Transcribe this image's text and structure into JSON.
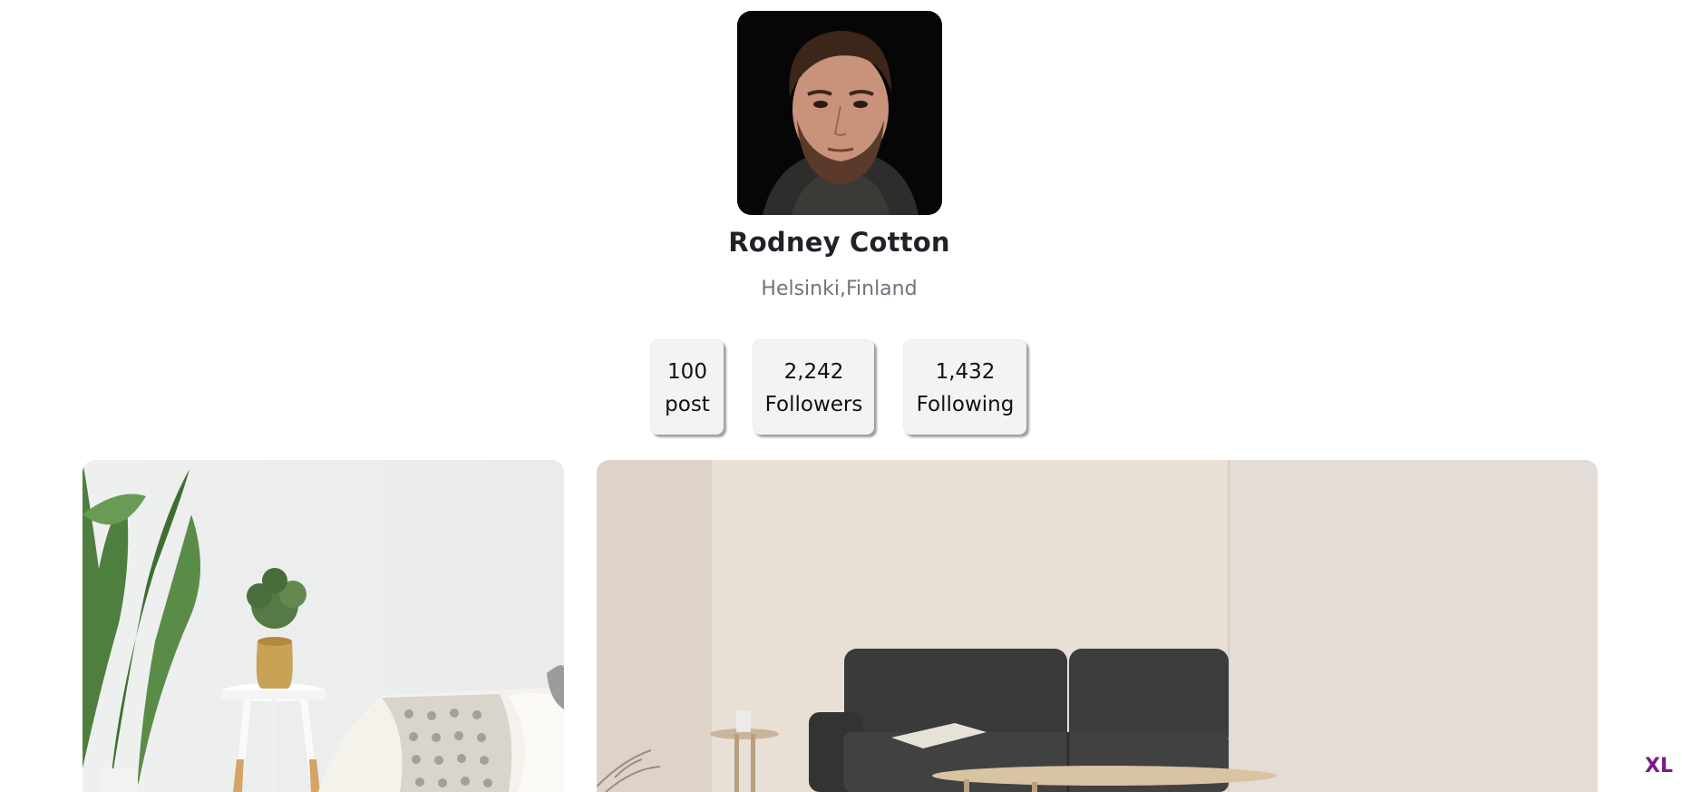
{
  "profile": {
    "name": "Rodney Cotton",
    "location": "Helsinki,Finland",
    "avatar_icon": "profile-portrait"
  },
  "stats": {
    "posts": {
      "value": "100",
      "label": "post"
    },
    "followers": {
      "value": "2,242",
      "label": "Followers"
    },
    "following": {
      "value": "1,432",
      "label": "Following"
    }
  },
  "gallery": {
    "photos": [
      {
        "icon": "photo-side-table-plant"
      },
      {
        "icon": "photo-living-room-sofa"
      }
    ]
  },
  "breakpoint_badge": "XL",
  "colors": {
    "background": "#ffffff",
    "stat_card": "#f3f3f3",
    "muted_text": "#6c757d",
    "badge": "#7a1a8c"
  }
}
